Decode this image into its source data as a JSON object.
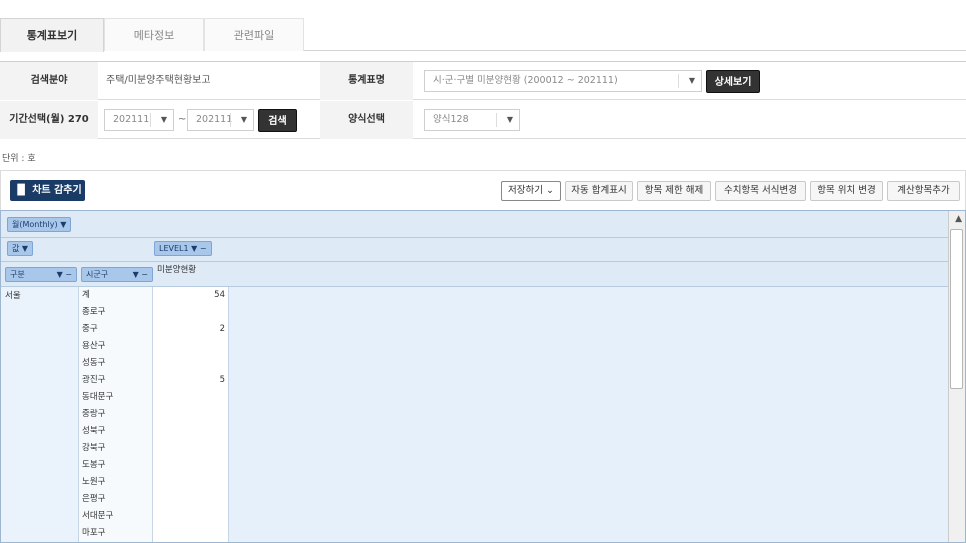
{
  "tabs": [
    "통계표보기",
    "메타정보",
    "관련파일"
  ],
  "form": {
    "field_label": "검색분야",
    "field_value": "주택/미분양주택현황보고",
    "stat_label": "통계표명",
    "stat_value": "시·군·구별 미분양현황 (200012 ~ 202111)",
    "detail_button": "상세보기",
    "period_label": "기간선택(월) 270",
    "period_from": "202111",
    "period_sep": "~",
    "period_to": "202111",
    "search_button": "검색",
    "format_label": "양식선택",
    "format_value": "양식128"
  },
  "unit_text": "단위 : 호",
  "toolbar": {
    "chart_button": "차트 감추기",
    "buttons": [
      "저장하기",
      "자동 합계표시",
      "항목 제한 해제",
      "수치항목 서식변경",
      "항목 위치 변경",
      "계산항목추가"
    ]
  },
  "pivot": {
    "period_pill": "월(Monthly)",
    "value_pill": "값",
    "level_pill": "LEVEL1",
    "col1_pill": "구분",
    "col2_pill": "시군구",
    "value_header": "미분양현황",
    "region": "서울",
    "rows": [
      {
        "district": "계",
        "value": "54"
      },
      {
        "district": "종로구",
        "value": ""
      },
      {
        "district": "중구",
        "value": "2"
      },
      {
        "district": "용산구",
        "value": ""
      },
      {
        "district": "성동구",
        "value": ""
      },
      {
        "district": "광진구",
        "value": "5"
      },
      {
        "district": "동대문구",
        "value": ""
      },
      {
        "district": "중랑구",
        "value": ""
      },
      {
        "district": "성북구",
        "value": ""
      },
      {
        "district": "강북구",
        "value": ""
      },
      {
        "district": "도봉구",
        "value": ""
      },
      {
        "district": "노원구",
        "value": ""
      },
      {
        "district": "은평구",
        "value": ""
      },
      {
        "district": "서대문구",
        "value": ""
      },
      {
        "district": "마포구",
        "value": ""
      }
    ]
  },
  "colors": {
    "chart_button": "#1a3b66",
    "grid_bg": "#e6f0fb",
    "pill_bg": "#a9c7ea"
  }
}
